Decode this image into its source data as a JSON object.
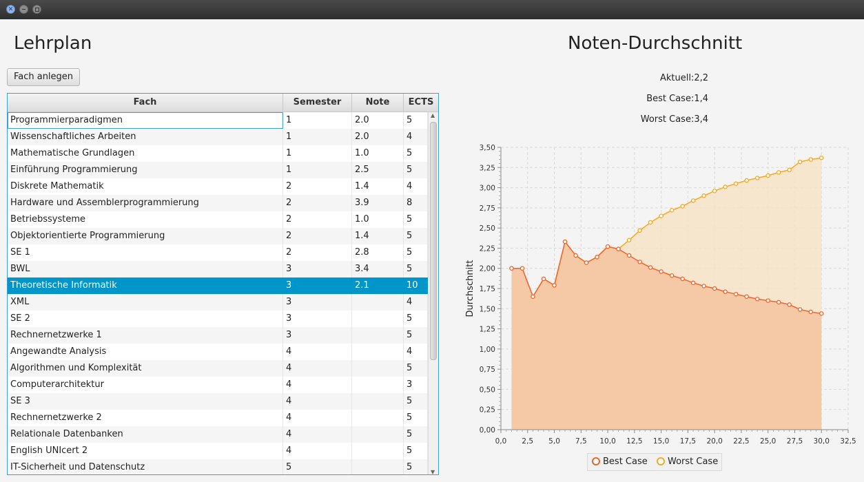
{
  "window": {
    "buttons": [
      "close",
      "minimize",
      "maximize"
    ]
  },
  "left": {
    "title": "Lehrplan",
    "add_button": "Fach anlegen",
    "columns": [
      "Fach",
      "Semester",
      "Note",
      "ECTS"
    ],
    "rows": [
      [
        "Programmierparadigmen",
        "1",
        "2.0",
        "5"
      ],
      [
        "Wissenschaftliches Arbeiten",
        "1",
        "2.0",
        "4"
      ],
      [
        "Mathematische Grundlagen",
        "1",
        "1.0",
        "5"
      ],
      [
        "Einführung Programmierung",
        "1",
        "2.5",
        "5"
      ],
      [
        "Diskrete Mathematik",
        "2",
        "1.4",
        "4"
      ],
      [
        "Hardware und Assemblerprogrammierung",
        "2",
        "3.9",
        "8"
      ],
      [
        "Betriebssysteme",
        "2",
        "1.0",
        "5"
      ],
      [
        "Objektorientierte Programmierung",
        "2",
        "1.4",
        "5"
      ],
      [
        "SE 1",
        "2",
        "2.8",
        "5"
      ],
      [
        "BWL",
        "3",
        "3.4",
        "5"
      ],
      [
        "Theoretische Informatik",
        "3",
        "2.1",
        "10"
      ],
      [
        "XML",
        "3",
        "",
        "4"
      ],
      [
        "SE 2",
        "3",
        "",
        "5"
      ],
      [
        "Rechnernetzwerke 1",
        "3",
        "",
        "5"
      ],
      [
        "Angewandte Analysis",
        "4",
        "",
        "4"
      ],
      [
        "Algorithmen und Komplexität",
        "4",
        "",
        "5"
      ],
      [
        "Computerarchitektur",
        "4",
        "",
        "3"
      ],
      [
        "SE 3",
        "4",
        "",
        "5"
      ],
      [
        "Rechnernetzwerke 2",
        "4",
        "",
        "5"
      ],
      [
        "Relationale Datenbanken",
        "4",
        "",
        "5"
      ],
      [
        "English UNIcert 2",
        "4",
        "",
        "5"
      ],
      [
        "IT-Sicherheit und Datenschutz",
        "5",
        "",
        "5"
      ]
    ],
    "selected_row": 10
  },
  "right": {
    "title": "Noten-Durchschnitt",
    "current": "Aktuell:2,2",
    "best": "Best Case:1,4",
    "worst": "Worst Case:3,4"
  },
  "chart_data": {
    "type": "area",
    "ylabel": "Durchschnitt",
    "xlabel": "",
    "xlim": [
      0,
      32.5
    ],
    "ylim": [
      0,
      3.5
    ],
    "x_ticks": [
      "0,0",
      "2,5",
      "5,0",
      "7,5",
      "10,0",
      "12,5",
      "15,0",
      "17,5",
      "20,0",
      "22,5",
      "25,0",
      "27,5",
      "30,0",
      "32,5"
    ],
    "y_ticks": [
      "0,00",
      "0,25",
      "0,50",
      "0,75",
      "1,00",
      "1,25",
      "1,50",
      "1,75",
      "2,00",
      "2,25",
      "2,50",
      "2,75",
      "3,00",
      "3,25",
      "3,50"
    ],
    "grid": true,
    "legend_position": "bottom",
    "series": [
      {
        "name": "Best Case",
        "color": "#f3622d",
        "fill": "#f5c9a5",
        "x": [
          1,
          2,
          3,
          4,
          5,
          6,
          7,
          8,
          9,
          10,
          11,
          12,
          13,
          14,
          15,
          16,
          17,
          18,
          19,
          20,
          21,
          22,
          23,
          24,
          25,
          26,
          27,
          28,
          29,
          30
        ],
        "y": [
          2.0,
          2.0,
          1.65,
          1.87,
          1.79,
          2.33,
          2.16,
          2.07,
          2.14,
          2.27,
          2.24,
          2.16,
          2.08,
          2.01,
          1.96,
          1.91,
          1.87,
          1.82,
          1.78,
          1.75,
          1.71,
          1.68,
          1.65,
          1.62,
          1.6,
          1.58,
          1.55,
          1.49,
          1.46,
          1.44
        ]
      },
      {
        "name": "Worst Case",
        "color": "#fba71b",
        "fill": "#f5e3c6",
        "x": [
          1,
          2,
          3,
          4,
          5,
          6,
          7,
          8,
          9,
          10,
          11,
          12,
          13,
          14,
          15,
          16,
          17,
          18,
          19,
          20,
          21,
          22,
          23,
          24,
          25,
          26,
          27,
          28,
          29,
          30
        ],
        "y": [
          2.0,
          2.0,
          1.65,
          1.87,
          1.79,
          2.33,
          2.16,
          2.07,
          2.14,
          2.27,
          2.24,
          2.35,
          2.47,
          2.57,
          2.65,
          2.72,
          2.77,
          2.84,
          2.9,
          2.96,
          3.01,
          3.05,
          3.09,
          3.12,
          3.15,
          3.19,
          3.22,
          3.32,
          3.35,
          3.37
        ]
      }
    ]
  }
}
